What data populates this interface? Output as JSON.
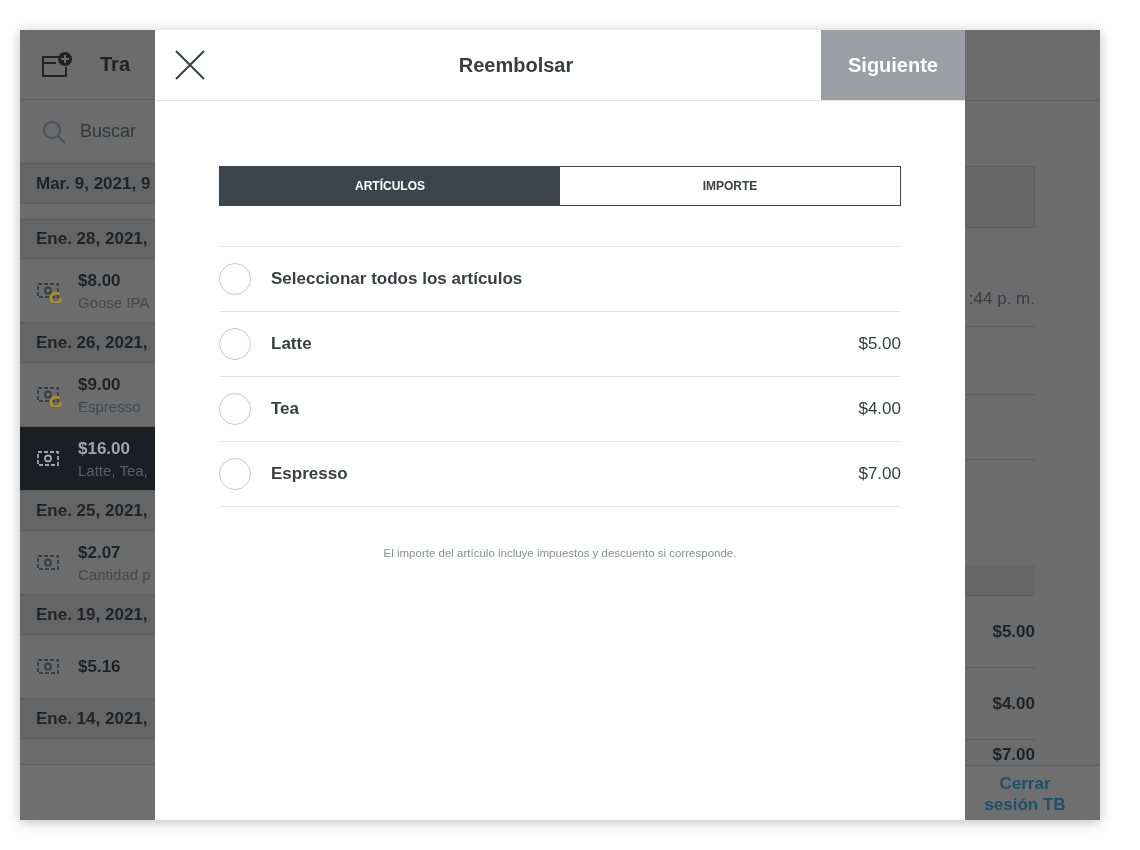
{
  "background_app": {
    "header_title": "Tra",
    "search": {
      "placeholder": "Buscar"
    },
    "transactions": [
      {
        "kind": "date",
        "label": "Mar. 9, 2021, 9"
      },
      {
        "kind": "date",
        "label": "Ene. 28, 2021,"
      },
      {
        "kind": "payment",
        "amount": "$8.00",
        "note": "Goose IPA",
        "refunded": true,
        "selected": false
      },
      {
        "kind": "date",
        "label": "Ene. 26, 2021,"
      },
      {
        "kind": "payment",
        "amount": "$9.00",
        "note": "Espresso",
        "refunded": true,
        "selected": false
      },
      {
        "kind": "payment",
        "amount": "$16.00",
        "note": "Latte, Tea,",
        "refunded": false,
        "selected": true
      },
      {
        "kind": "date",
        "label": "Ene. 25, 2021,"
      },
      {
        "kind": "payment",
        "amount": "$2.07",
        "note": "Cantidad p",
        "refunded": false,
        "selected": false
      },
      {
        "kind": "date",
        "label": "Ene. 19, 2021,"
      },
      {
        "kind": "payment",
        "amount": "$5.16",
        "refunded": false,
        "selected": false
      },
      {
        "kind": "date",
        "label": "Ene. 14, 2021,"
      }
    ],
    "detail": {
      "time": ":44 p. m.",
      "item_prices": [
        "$5.00",
        "$4.00",
        "$7.00"
      ]
    },
    "logout_link": "Cerrar sesión TB"
  },
  "modal": {
    "title": "Reembolsar",
    "next_button": {
      "label": "Siguiente",
      "disabled": true
    },
    "tabs": [
      {
        "label": "ARTÍCULOS",
        "selected": true
      },
      {
        "label": "IMPORTE",
        "selected": false
      }
    ],
    "items": [
      {
        "kind": "select_all",
        "label": "Seleccionar todos los artículos",
        "checked": false
      },
      {
        "kind": "item",
        "label": "Latte",
        "price": "$5.00",
        "checked": false
      },
      {
        "kind": "item",
        "label": "Tea",
        "price": "$4.00",
        "checked": false
      },
      {
        "kind": "item",
        "label": "Espresso",
        "price": "$7.00",
        "checked": false
      }
    ],
    "note": "El importe del artículo incluye impuestos y descuento si corresponde."
  }
}
